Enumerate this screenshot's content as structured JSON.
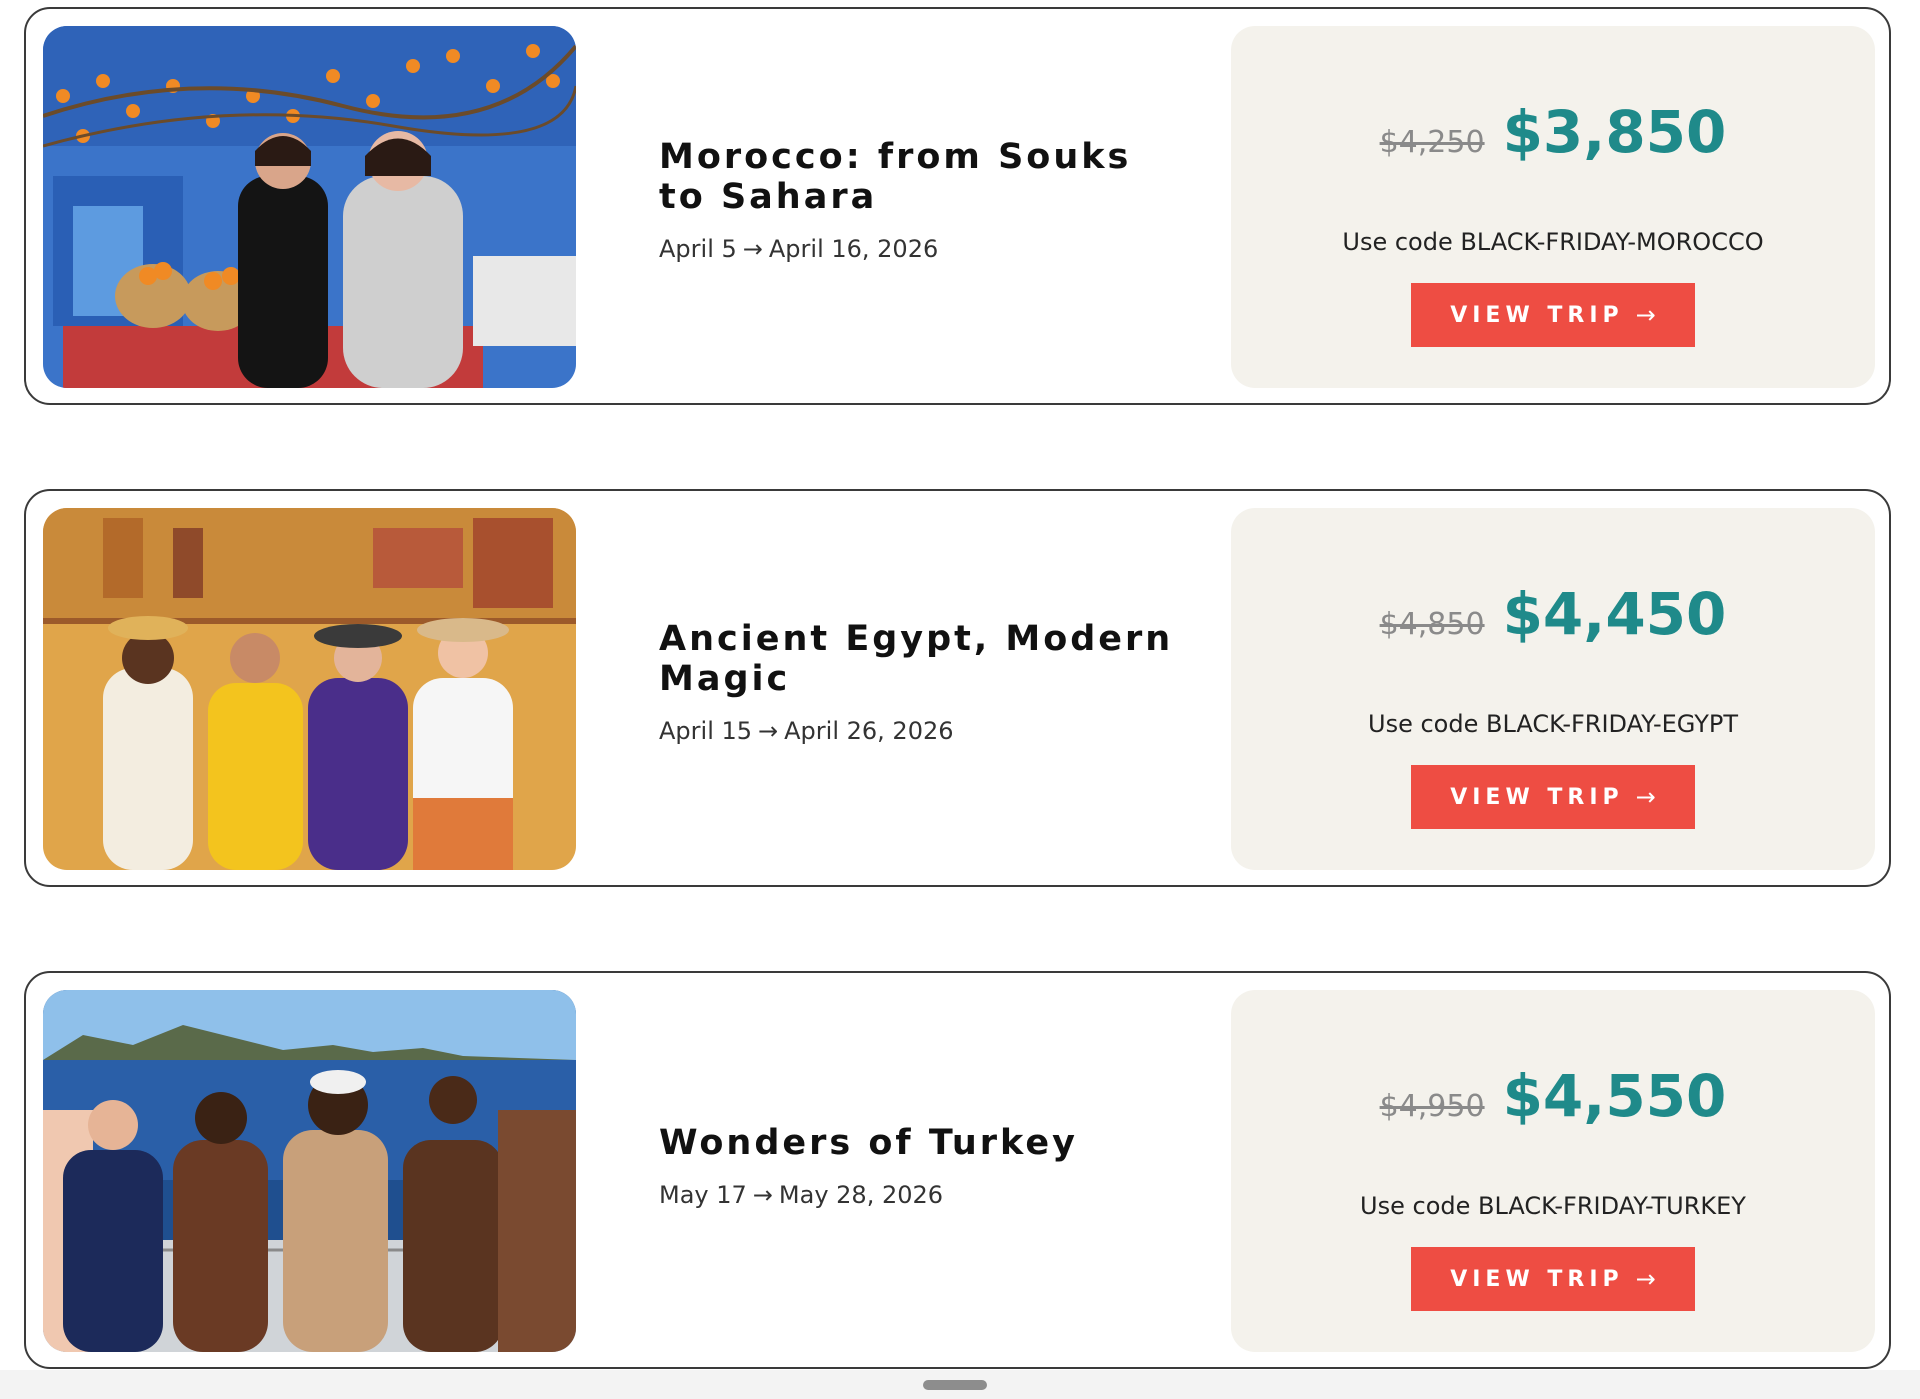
{
  "trips": [
    {
      "title": "Morocco: from Souks to Sahara",
      "start_date": "April 5",
      "end_date": "April 16, 2026",
      "arrow": "→",
      "old_price": "$4,250",
      "new_price": "$3,850",
      "code_text": "Use code BLACK-FRIDAY-MOROCCO",
      "button_label": "VIEW TRIP",
      "button_arrow": "→"
    },
    {
      "title": "Ancient Egypt, Modern Magic",
      "start_date": "April 15",
      "end_date": "April 26, 2026",
      "arrow": "→",
      "old_price": "$4,850",
      "new_price": "$4,450",
      "code_text": "Use code BLACK-FRIDAY-EGYPT",
      "button_label": "VIEW TRIP",
      "button_arrow": "→"
    },
    {
      "title": "Wonders of Turkey",
      "start_date": "May 17",
      "end_date": "May 28, 2026",
      "arrow": "→",
      "old_price": "$4,950",
      "new_price": "$4,550",
      "code_text": "Use code BLACK-FRIDAY-TURKEY",
      "button_label": "VIEW TRIP",
      "button_arrow": "→"
    }
  ],
  "colors": {
    "accent_teal": "#1f8a8a",
    "button_red": "#ee4d43",
    "panel_beige": "#f4f2ec"
  }
}
